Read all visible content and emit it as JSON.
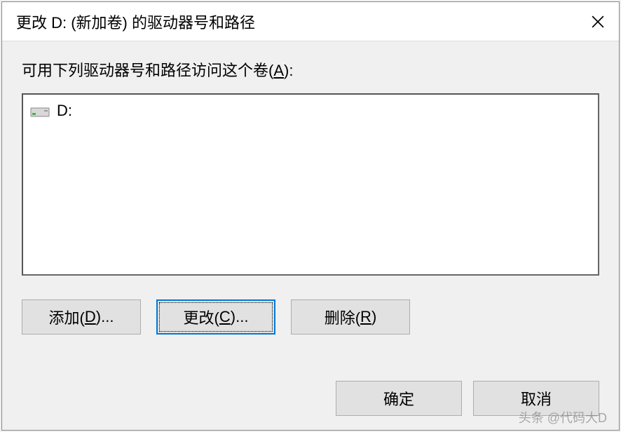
{
  "titlebar": {
    "title": "更改 D: (新加卷) 的驱动器号和路径"
  },
  "content": {
    "instruction_prefix": "可用下列驱动器号和路径访问这个卷(",
    "instruction_key": "A",
    "instruction_suffix": "):",
    "list_items": [
      {
        "label": "D:"
      }
    ]
  },
  "buttons": {
    "add": {
      "prefix": "添加(",
      "key": "D",
      "suffix": ")..."
    },
    "change": {
      "prefix": "更改(",
      "key": "C",
      "suffix": ")..."
    },
    "remove": {
      "prefix": "删除(",
      "key": "R",
      "suffix": ")"
    }
  },
  "footer": {
    "ok": "确定",
    "cancel": "取消"
  },
  "watermark": "头条 @代码大D"
}
